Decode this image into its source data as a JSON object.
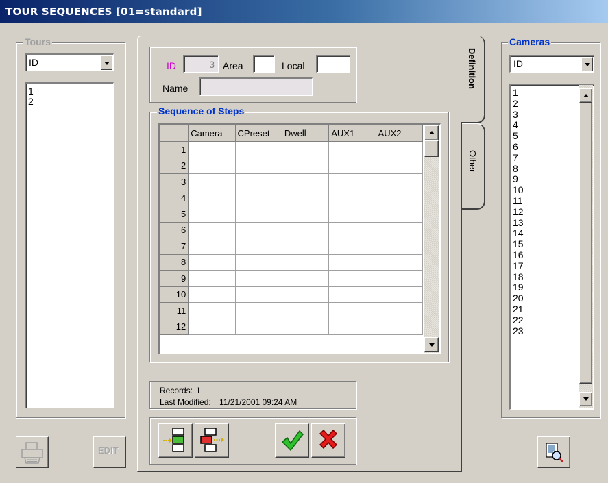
{
  "window": {
    "title": "TOUR SEQUENCES [01=standard]"
  },
  "tours": {
    "legend": "Tours",
    "sort_value": "ID",
    "items": [
      "1",
      "2"
    ]
  },
  "cameras": {
    "legend": "Cameras",
    "sort_value": "ID",
    "items": [
      "1",
      "2",
      "3",
      "4",
      "5",
      "6",
      "7",
      "8",
      "9",
      "10",
      "11",
      "12",
      "13",
      "14",
      "15",
      "16",
      "17",
      "18",
      "19",
      "20",
      "21",
      "22",
      "23"
    ]
  },
  "tabs": {
    "definition": "Definition",
    "other": "Other"
  },
  "definition": {
    "id_label": "ID",
    "id_value": "3",
    "area_label": "Area",
    "area_value": "",
    "local_label": "Local",
    "local_value": "",
    "name_label": "Name",
    "name_value": ""
  },
  "sequence": {
    "legend": "Sequence of Steps",
    "columns": [
      "Camera",
      "CPreset",
      "Dwell",
      "AUX1",
      "AUX2"
    ],
    "rows": [
      "1",
      "2",
      "3",
      "4",
      "5",
      "6",
      "7",
      "8",
      "9",
      "10",
      "11",
      "12"
    ]
  },
  "status": {
    "records_label": "Records:",
    "records_value": "1",
    "modified_label": "Last Modified:",
    "modified_value": "11/21/2001 09:24 AM"
  },
  "bottom": {
    "edit_label": "EDIT"
  },
  "colors": {
    "id_label": "#cc00cc",
    "legend_blue": "#0033cc",
    "accept": "#1aa81a",
    "reject": "#dd1111"
  }
}
